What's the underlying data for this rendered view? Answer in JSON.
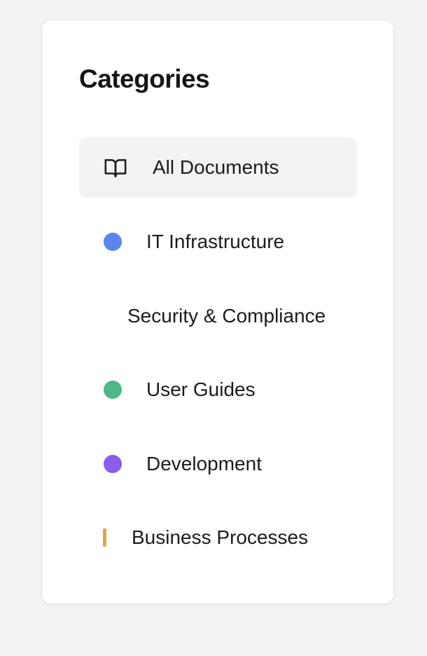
{
  "panel": {
    "title": "Categories"
  },
  "categories": [
    {
      "label": "All Documents",
      "icon": "book-icon",
      "active": true
    },
    {
      "label": "IT Infrastructure",
      "icon": "dot",
      "color": "#5b86ef"
    },
    {
      "label": "Security & Compliance",
      "icon": "none"
    },
    {
      "label": "User Guides",
      "icon": "dot",
      "color": "#4fb886"
    },
    {
      "label": "Development",
      "icon": "dot",
      "color": "#8c5ced"
    },
    {
      "label": "Business Processes",
      "icon": "bar",
      "color": "#e5a33a"
    }
  ]
}
